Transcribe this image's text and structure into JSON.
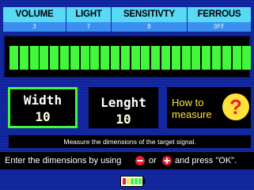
{
  "settings": [
    {
      "label": "VOLUME",
      "value": "3"
    },
    {
      "label": "LIGHT",
      "value": "7"
    },
    {
      "label": "SENSITIVTY",
      "value": "8"
    },
    {
      "label": "FERROUS",
      "value": "OFF"
    }
  ],
  "signal": {
    "bar_count": 24,
    "level": 1.0,
    "bar_color": "#43f83b"
  },
  "dimensions": {
    "width": {
      "label": "Width",
      "value": "10"
    },
    "length": {
      "label": "Lenght",
      "value": "10"
    }
  },
  "howto": {
    "line1": "How to",
    "line2": "measure",
    "icon": "question-mark-icon"
  },
  "info_text": "Measure the dimensions of the target signal.",
  "instruction": {
    "part1": "Enter the dimensions by using",
    "minus_icon": "minus-icon",
    "part2": "or",
    "plus_icon": "plus-icon",
    "part3": "and press \"OK\"."
  },
  "battery": {
    "icon": "battery-icon",
    "level": 1.0
  },
  "colors": {
    "background": "#0a1f9a",
    "header_cyan": "#58d9f5",
    "value_blue": "#3a8ff1",
    "signal_green": "#43f83b",
    "accent_yellow": "#ffe23a",
    "icon_red": "#e8202a"
  }
}
